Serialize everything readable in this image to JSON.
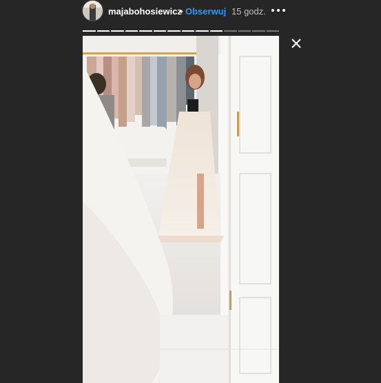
{
  "header": {
    "username": "majabohosiewicz",
    "separator": "•",
    "follow_label": "Obserwuj",
    "timestamp": "15 godz.",
    "more_icon": "more-horizontal-icon",
    "avatar_icon": "avatar"
  },
  "progress": {
    "segments_total": 14,
    "segments_done": 10
  },
  "close_icon": "close-icon",
  "colors": {
    "background": "#262626",
    "follow_blue": "#3897f0",
    "segment_done": "#ffffff",
    "segment_pending": "#7a7a7a"
  }
}
